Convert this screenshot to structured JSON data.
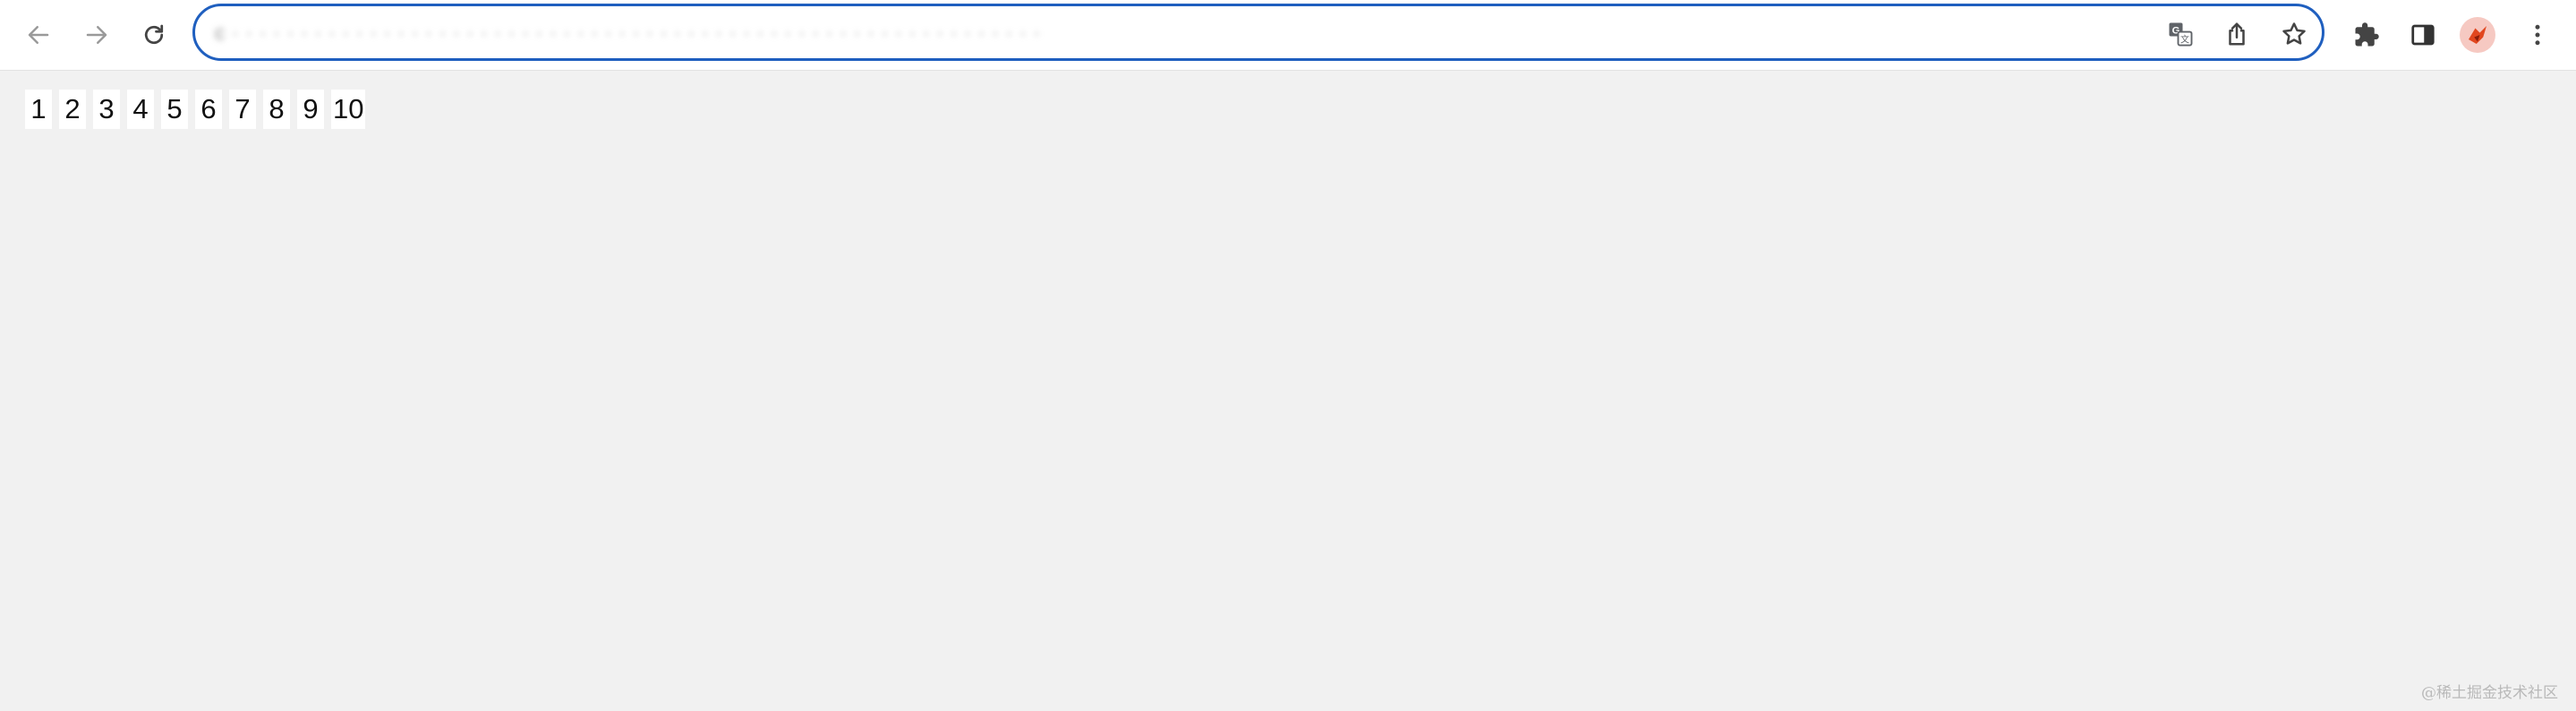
{
  "browser": {
    "url_text": "c  ·  · ·  ·  · · · ·  ·  ·  · · ·  ·  ·  · ·  ·  ·  ·  ·  ·  ·  · · ·  ·  ·  ·  ·  ·  ·  ·  · ·  ·  ·  ·  ·  ·  ·  ·  · · · ·  ·  ·  ·  ·  ·  ·  ·  ·  ·  ·  ·  ·  ·",
    "icons": {
      "back": "arrow-left-icon",
      "forward": "arrow-right-icon",
      "reload": "reload-icon",
      "translate": "translate-icon",
      "share": "share-icon",
      "bookmark": "star-icon",
      "extensions": "puzzle-icon",
      "side_panel": "side-panel-icon",
      "profile": "profile-avatar",
      "menu": "kebab-menu-icon"
    },
    "accent_color": "#1f5fbf"
  },
  "page": {
    "pages": [
      "1",
      "2",
      "3",
      "4",
      "5",
      "6",
      "7",
      "8",
      "9",
      "10"
    ],
    "background_color": "#f1f1f1"
  },
  "watermark": "@稀土掘金技术社区"
}
